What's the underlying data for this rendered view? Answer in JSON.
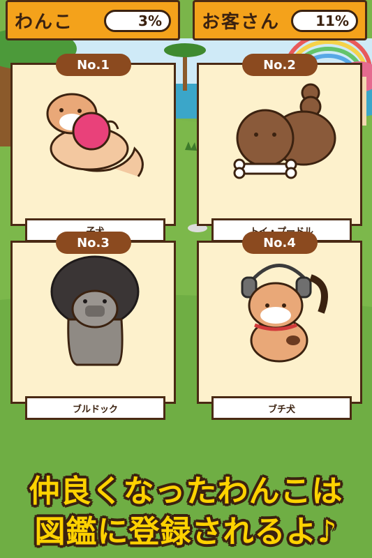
{
  "header": {
    "dog_label": "わんこ",
    "dog_percent": "3%",
    "guest_label": "お客さん",
    "guest_percent": "11%"
  },
  "cards": [
    {
      "number": "No.1",
      "name": "子犬"
    },
    {
      "number": "No.2",
      "name": "トイ・プードル"
    },
    {
      "number": "No.3",
      "name": "ブルドック"
    },
    {
      "number": "No.4",
      "name": "ブチ犬"
    }
  ],
  "banner": {
    "line1": "仲良くなったわんこは",
    "line2": "図鑑に登録されるよ♪"
  },
  "colors": {
    "orange": "#f4a21b",
    "brown": "#8b4a1f",
    "cream": "#fdf1cc",
    "yellow_text": "#ffd200",
    "grass": "#7ab54a"
  }
}
